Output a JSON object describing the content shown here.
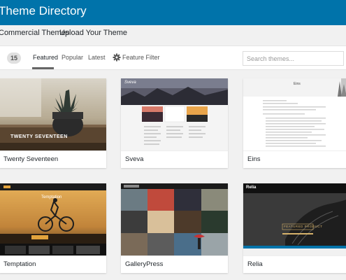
{
  "header": {
    "title": "Theme Directory"
  },
  "nav": {
    "items": [
      {
        "label": "Commercial Themes"
      },
      {
        "label": "Upload Your Theme"
      }
    ]
  },
  "filter_bar": {
    "count": "15",
    "tabs": [
      {
        "label": "Featured",
        "active": true
      },
      {
        "label": "Popular"
      },
      {
        "label": "Latest"
      }
    ],
    "feature_filter": "Feature Filter",
    "search_placeholder": "Search themes..."
  },
  "themes": [
    {
      "name": "Twenty Seventeen",
      "overlay": "TWENTY SEVENTEEN"
    },
    {
      "name": "Sveva",
      "overlay": "Sveva"
    },
    {
      "name": "Eins",
      "overlay": "Eins"
    },
    {
      "name": "Temptation",
      "overlay": "Temptation"
    },
    {
      "name": "GalleryPress",
      "overlay": ""
    },
    {
      "name": "Relia",
      "overlay": "Relia",
      "overlay2": "FEATURED PRODUCT"
    }
  ],
  "colors": {
    "header_bg": "#0073aa",
    "accent": "#0073aa"
  },
  "icons": {
    "feature_filter": "gear-icon"
  }
}
